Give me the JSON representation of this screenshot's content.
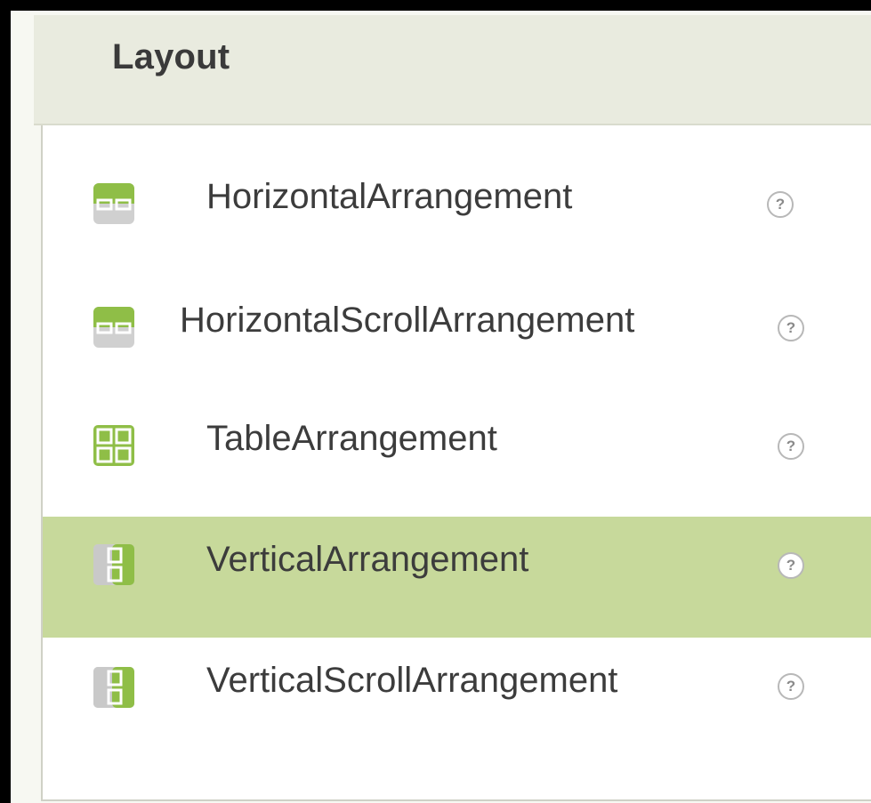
{
  "palette": {
    "section_title": "Layout",
    "items": [
      {
        "label": "HorizontalArrangement",
        "icon": "horizontal-arrangement-icon",
        "selected": false
      },
      {
        "label": "HorizontalScrollArrangement",
        "icon": "horizontal-scroll-arrangement-icon",
        "selected": false
      },
      {
        "label": "TableArrangement",
        "icon": "table-arrangement-icon",
        "selected": false
      },
      {
        "label": "VerticalArrangement",
        "icon": "vertical-arrangement-icon",
        "selected": true
      },
      {
        "label": "VerticalScrollArrangement",
        "icon": "vertical-scroll-arrangement-icon",
        "selected": false
      }
    ],
    "help_glyph": "?"
  },
  "colors": {
    "header_bg": "#e9ebdf",
    "selected_bg": "#c7d99b",
    "icon_green": "#8fbe47",
    "icon_gray": "#c9c9c9"
  }
}
